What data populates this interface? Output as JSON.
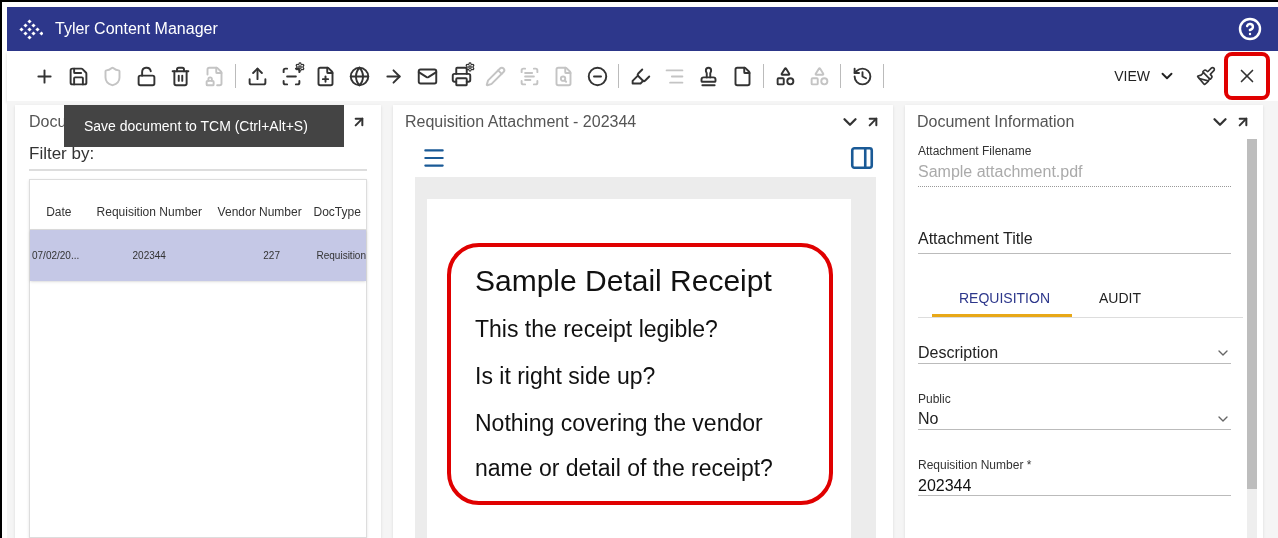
{
  "window": {
    "title": "Tyler Content Manager"
  },
  "toolbar": [
    {
      "kind": "add",
      "disabled": false
    },
    {
      "kind": "save",
      "disabled": false
    },
    {
      "kind": "shield",
      "disabled": true
    },
    {
      "kind": "unlock",
      "disabled": false
    },
    {
      "kind": "delete",
      "disabled": false
    },
    {
      "kind": "file-lock",
      "disabled": true
    },
    {
      "kind": "separator"
    },
    {
      "kind": "upload",
      "disabled": false
    },
    {
      "kind": "scanner",
      "disabled": false
    },
    {
      "kind": "file-add",
      "disabled": false
    },
    {
      "kind": "globe",
      "disabled": false
    },
    {
      "kind": "forward",
      "disabled": false
    },
    {
      "kind": "mail",
      "disabled": false
    },
    {
      "kind": "printer",
      "disabled": false
    },
    {
      "kind": "pencil",
      "disabled": true
    },
    {
      "kind": "text-box",
      "disabled": true
    },
    {
      "kind": "file-search",
      "disabled": true
    },
    {
      "kind": "minus",
      "disabled": false
    },
    {
      "kind": "separator"
    },
    {
      "kind": "highlighter",
      "disabled": false
    },
    {
      "kind": "lines",
      "disabled": true
    },
    {
      "kind": "stamp",
      "disabled": false
    },
    {
      "kind": "page",
      "disabled": false
    },
    {
      "kind": "separator"
    },
    {
      "kind": "shapes",
      "disabled": false
    },
    {
      "kind": "shapes-history",
      "disabled": true
    },
    {
      "kind": "separator"
    },
    {
      "kind": "history",
      "disabled": false
    },
    {
      "kind": "separator"
    }
  ],
  "view_menu": {
    "label": "VIEW"
  },
  "tooltip": "Save document to TCM (Ctrl+Alt+S)",
  "left_panel": {
    "title": "Docu",
    "filter_label": "Filter by:",
    "table": {
      "columns": [
        "Date",
        "Requisition Number",
        "Vendor Number",
        "DocType"
      ],
      "rows": [
        {
          "cells": [
            "07/02/20...",
            "202344",
            "227",
            "Requisition"
          ],
          "selected": true
        }
      ]
    }
  },
  "viewer": {
    "title": "Requisition Attachment - 202344",
    "document": {
      "heading": "Sample Detail Receipt",
      "lines": [
        "This the receipt legible?",
        "Is it right side up?",
        "Nothing covering the vendor name or detail of the receipt?"
      ]
    }
  },
  "info_panel": {
    "title": "Document Information",
    "filename": {
      "label": "Attachment Filename",
      "value": "Sample attachment.pdf",
      "readonly": true
    },
    "title_field": {
      "placeholder": "Attachment Title"
    },
    "tabs": [
      {
        "label": "REQUISITION",
        "selected": true
      },
      {
        "label": "AUDIT",
        "selected": false
      }
    ],
    "fields": [
      {
        "kind": "select",
        "placeholder": "Description"
      },
      {
        "kind": "select",
        "label": "Public",
        "value": "No"
      },
      {
        "kind": "text",
        "label": "Requisition Number *",
        "value": "202344"
      }
    ]
  }
}
